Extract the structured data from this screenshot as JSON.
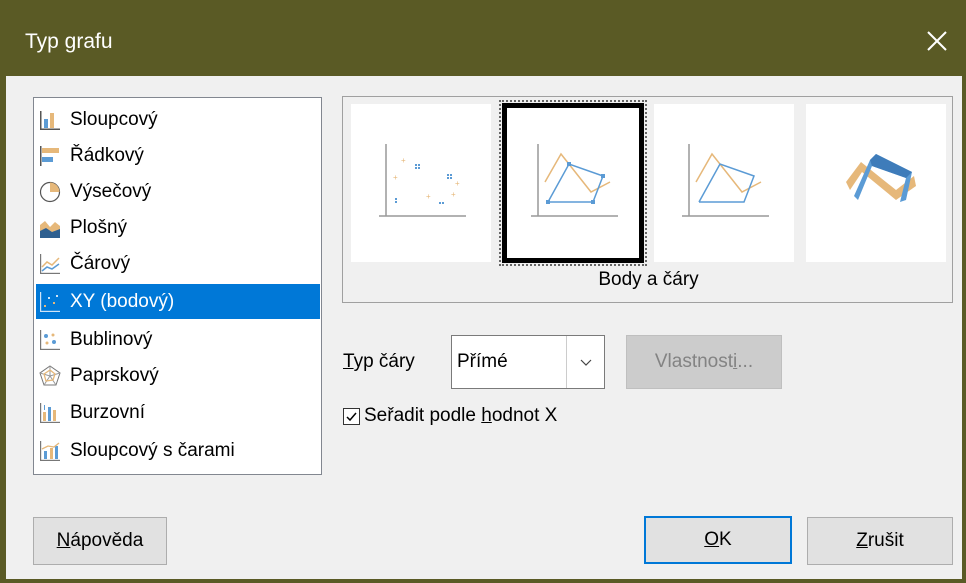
{
  "window": {
    "title": "Typ grafu",
    "close_icon": "close-icon"
  },
  "chart_types": [
    {
      "label": "Sloupcový",
      "icon": "column-chart-icon",
      "selected": false
    },
    {
      "label": "Řádkový",
      "icon": "bar-chart-icon",
      "selected": false
    },
    {
      "label": "Výsečový",
      "icon": "pie-chart-icon",
      "selected": false
    },
    {
      "label": "Plošný",
      "icon": "area-chart-icon",
      "selected": false
    },
    {
      "label": "Čárový",
      "icon": "line-chart-icon",
      "selected": false
    },
    {
      "label": "XY (bodový)",
      "icon": "xy-scatter-icon",
      "selected": true
    },
    {
      "label": "Bublinový",
      "icon": "bubble-chart-icon",
      "selected": false
    },
    {
      "label": "Paprskový",
      "icon": "net-chart-icon",
      "selected": false
    },
    {
      "label": "Burzovní",
      "icon": "stock-chart-icon",
      "selected": false
    },
    {
      "label": "Sloupcový s čarami",
      "icon": "column-line-chart-icon",
      "selected": false
    }
  ],
  "variants": {
    "items": [
      {
        "name": "points-only",
        "selected": false
      },
      {
        "name": "points-and-lines",
        "selected": true
      },
      {
        "name": "lines-only",
        "selected": false
      },
      {
        "name": "3d-lines",
        "selected": false
      }
    ],
    "caption": "Body a čáry"
  },
  "line_type": {
    "label_mnemonic": "T",
    "label_rest": "yp čáry",
    "value": "Přímé"
  },
  "properties_button": {
    "label_pre": "Vlastnost",
    "label_mnemonic": "i",
    "label_post": "..."
  },
  "sort_by_x": {
    "checked": true,
    "label_pre": "Seřadit podle ",
    "label_mnemonic": "h",
    "label_post": "odnot X"
  },
  "buttons": {
    "help_mnemonic": "N",
    "help_rest": "ápověda",
    "ok_mnemonic": "O",
    "ok_rest": "K",
    "cancel_mnemonic": "Z",
    "cancel_rest": "rušit"
  },
  "colors": {
    "titlebar": "#5a5a25",
    "selection": "#0078d7",
    "series1": "#e6b87a",
    "series2": "#5b9bd5"
  }
}
